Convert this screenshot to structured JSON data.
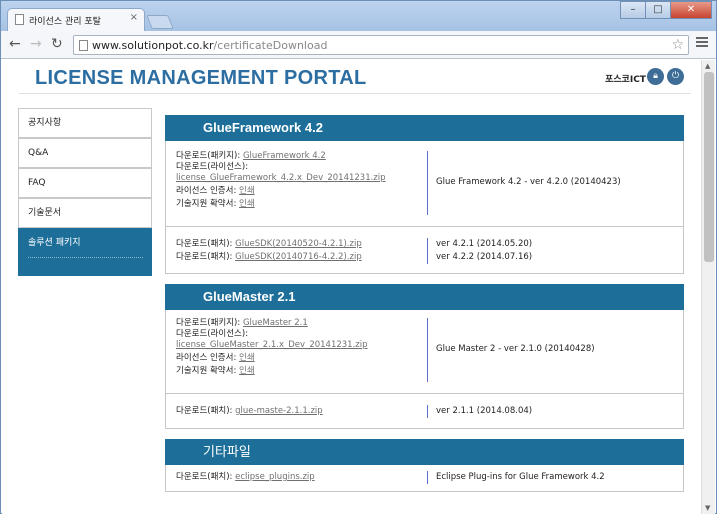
{
  "browser": {
    "tab_title": "라이선스 관리 포탈",
    "url_host": "www.solutionpot.co.kr",
    "url_path": "/certificateDownload"
  },
  "page": {
    "title": "LICENSE MANAGEMENT PORTAL",
    "brand": "포스코ICT"
  },
  "sidebar": {
    "items": [
      {
        "label": "공지사항"
      },
      {
        "label": "Q&A"
      },
      {
        "label": "FAQ"
      },
      {
        "label": "기술문서"
      },
      {
        "label": "솔루션 패키지"
      }
    ]
  },
  "sections": [
    {
      "title": "GlueFramework 4.2",
      "package": {
        "pkg_label": "다운로드(패키지):",
        "pkg_link": "GlueFramework 4.2",
        "lic_label": "다운로드(라이선스):",
        "lic_link": "license_GlueFramework_4.2.x_Dev_20141231.zip",
        "cert_label": "라이선스 인증서:",
        "cert_link": "인쇄",
        "support_label": "기술지원 확약서:",
        "support_link": "인쇄",
        "version": "Glue Framework 4.2 - ver 4.2.0 (20140423)"
      },
      "patches": [
        {
          "label": "다운로드(패치):",
          "link": "GlueSDK(20140520-4.2.1).zip",
          "version": "ver 4.2.1 (2014.05.20)"
        },
        {
          "label": "다운로드(패치):",
          "link": "GlueSDK(20140716-4.2.2).zip",
          "version": "ver 4.2.2 (2014.07.16)"
        }
      ]
    },
    {
      "title": "GlueMaster 2.1",
      "package": {
        "pkg_label": "다운로드(패키지):",
        "pkg_link": "GlueMaster 2.1",
        "lic_label": "다운로드(라이선스):",
        "lic_link": "license_GlueMaster_2.1.x_Dev_20141231.zip",
        "cert_label": "라이선스 인증서:",
        "cert_link": "인쇄",
        "support_label": "기술지원 확약서:",
        "support_link": "인쇄",
        "version": "Glue Master 2 - ver 2.1.0 (20140428)"
      },
      "patches": [
        {
          "label": "다운로드(패치):",
          "link": "glue-maste-2.1.1.zip",
          "version": "ver 2.1.1 (2014.08.04)"
        }
      ]
    },
    {
      "title": "기타파일",
      "patches": [
        {
          "label": "다운로드(패치):",
          "link": "eclipse_plugins.zip",
          "version": "Eclipse Plug-ins for Glue Framework 4.2"
        }
      ]
    }
  ]
}
